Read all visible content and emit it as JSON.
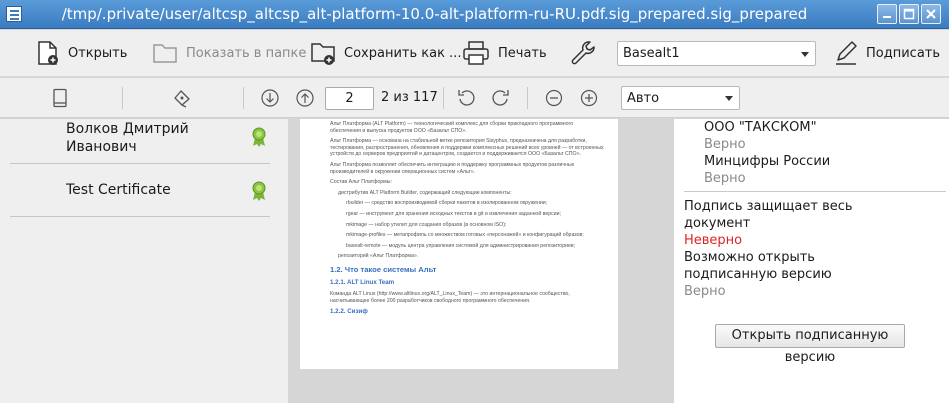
{
  "window": {
    "title": "/tmp/.private/user/altcsp_altcsp_alt-platform-10.0-alt-platform-ru-RU.pdf.sig_prepared.sig_prepared"
  },
  "toolbar": {
    "open": "Открыть",
    "show_in_folder": "Показать в папке",
    "save_as": "Сохранить как ...",
    "print": "Печать",
    "certificate": "Basealt1",
    "sign": "Подписать"
  },
  "nav": {
    "page": "2",
    "page_of": "2 из 117",
    "zoom": "Авто"
  },
  "signatures": [
    {
      "name": "Волков Дмитрий Иванович",
      "status_color": "#8cc63f"
    },
    {
      "name": "Test Certificate",
      "status_color": "#8cc63f"
    }
  ],
  "document": {
    "paragraphs": [
      "Альт Платформа (ALT Platform) — технологический комплекс для сборки прикладного программного обеспечения и выпуска продуктов ООО «Базальт СПО».",
      "Альт Платформа — основана на стабильной ветке репозитория Sisyphus, предназначена для разработки, тестирования, распространения, обновления и поддержки комплексных решений всех уровней — от встроенных устройств до серверов предприятий и датацентров, создается и поддерживается ООО «Базальт СПО».",
      "Альт Платформа позволяет обеспечить интеграцию и поддержку программных продуктов различных производителей в окружении операционных систем «Альт».",
      "Состав Альт Платформы:",
      "дистрибутив ALT Platform Builder, содержащий следующие компоненты:",
      "rbuilder — средство воспроизводимой сборки пакетов в изолированном окружении;",
      "rgear — инструмент для хранения исходных текстов в git и извлечения заданной версии;",
      "mkimage — набор утилит для создания образов (в основном ISO);",
      "mkimage-profiles — метапрофиль со множеством готовых «персонажей» и конфигураций образов;",
      "basealt-remote — модуль центра управления системой для администрирования репозиториев;",
      "репозиторий «Альт Платформа»."
    ],
    "heading1": "1.2. Что такое системы Альт",
    "heading2": "1.2.1. ALT Linux Team",
    "team_text": "Команда ALT Linux (http://www.altlinux.org/ALT_Linux_Team) — это интернациональное сообщество, насчитывающее более 200 разработчиков свободного программного обеспечения.",
    "heading3": "1.2.2. Сизиф"
  },
  "details": {
    "issuer1": "ООО \"ТАКСКОМ\"",
    "issuer1_status": "Верно",
    "issuer2": "Минцифры России",
    "issuer2_status": "Верно",
    "whole_doc_label": "Подпись защищает весь документ",
    "whole_doc_status": "Неверно",
    "open_version_label": "Возможно открыть подписанную версию",
    "open_version_status": "Верно",
    "open_version_button": "Открыть подписанную версию"
  }
}
